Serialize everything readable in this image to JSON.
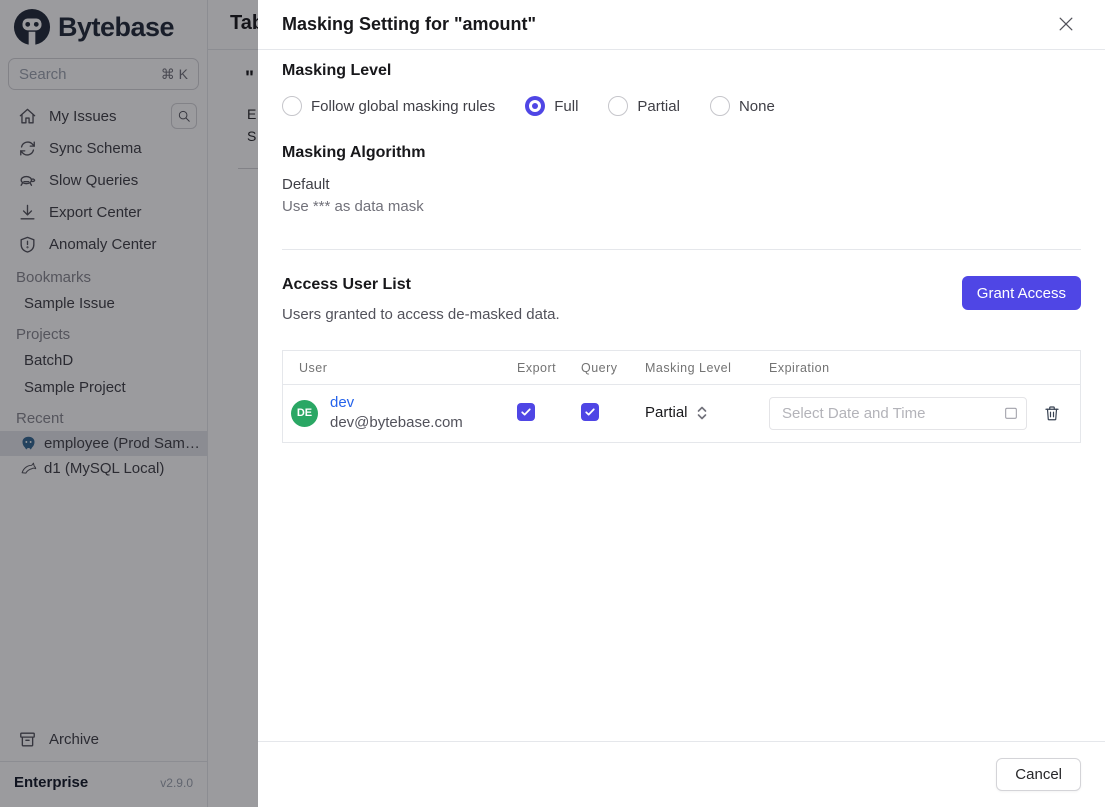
{
  "sidebar": {
    "logo": "Bytebase",
    "search": {
      "placeholder": "Search",
      "shortcut": "⌘ K"
    },
    "nav": [
      {
        "label": "My Issues"
      },
      {
        "label": "Sync Schema"
      },
      {
        "label": "Slow Queries"
      },
      {
        "label": "Export Center"
      },
      {
        "label": "Anomaly Center"
      }
    ],
    "sections": [
      {
        "header": "Bookmarks",
        "items": [
          {
            "label": "Sample Issue"
          }
        ]
      },
      {
        "header": "Projects",
        "items": [
          {
            "label": "BatchD"
          },
          {
            "label": "Sample Project"
          }
        ]
      },
      {
        "header": "Recent",
        "items": [
          {
            "label": "employee (Prod Sam…",
            "selected": true
          },
          {
            "label": "d1 (MySQL Local)",
            "selected": false
          }
        ]
      }
    ],
    "archive": "Archive",
    "plan": "Enterprise",
    "version": "v2.9.0"
  },
  "background_page": {
    "title_fragment": "Tab",
    "fragment_quote": "\"",
    "fragment_line1": "E",
    "fragment_line2": "S"
  },
  "modal": {
    "title": "Masking Setting for \"amount\"",
    "masking_level": {
      "heading": "Masking Level",
      "options": [
        {
          "label": "Follow global masking rules",
          "selected": false
        },
        {
          "label": "Full",
          "selected": true
        },
        {
          "label": "Partial",
          "selected": false
        },
        {
          "label": "None",
          "selected": false
        }
      ]
    },
    "masking_algorithm": {
      "heading": "Masking Algorithm",
      "value": "Default",
      "description": "Use *** as data mask"
    },
    "access": {
      "heading": "Access User List",
      "subtitle": "Users granted to access de-masked data.",
      "grant_button": "Grant Access",
      "table": {
        "columns": [
          "User",
          "Export",
          "Query",
          "Masking Level",
          "Expiration"
        ],
        "rows": [
          {
            "avatar_initials": "DE",
            "name": "dev",
            "email": "dev@bytebase.com",
            "export_checked": true,
            "query_checked": true,
            "masking_level": "Partial",
            "expiration_placeholder": "Select Date and Time"
          }
        ]
      }
    },
    "cancel_button": "Cancel"
  },
  "colors": {
    "accent_indigo": "#4f46e5",
    "avatar_green": "#2aa764",
    "link_blue": "#2563eb",
    "selected_row_bg": "#e4e6ea"
  }
}
